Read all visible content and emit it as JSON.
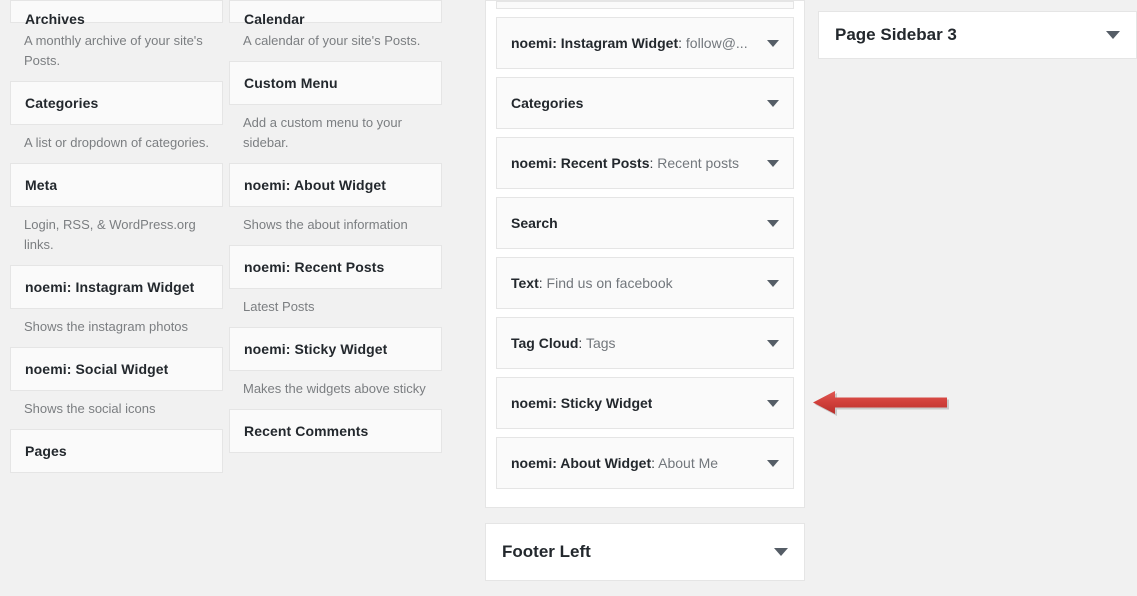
{
  "available_widgets": {
    "columns": [
      {
        "items": [
          {
            "title": "Archives",
            "description": "A monthly archive of your site's Posts.",
            "clipped": true
          },
          {
            "title": "Categories",
            "description": "A list or dropdown of categories.",
            "clipped": false
          },
          {
            "title": "Meta",
            "description": "Login, RSS, & WordPress.org links.",
            "clipped": false
          },
          {
            "title": "noemi: Instagram Widget",
            "description": "Shows the instagram photos",
            "clipped": false
          },
          {
            "title": "noemi: Social Widget",
            "description": "Shows the social icons",
            "clipped": false
          },
          {
            "title": "Pages",
            "description": "",
            "clipped": false
          }
        ]
      },
      {
        "items": [
          {
            "title": "Calendar",
            "description": "A calendar of your site's Posts.",
            "clipped": true
          },
          {
            "title": "Custom Menu",
            "description": "Add a custom menu to your sidebar.",
            "clipped": false
          },
          {
            "title": "noemi: About Widget",
            "description": "Shows the about information",
            "clipped": false
          },
          {
            "title": "noemi: Recent Posts",
            "description": "Latest Posts",
            "clipped": false
          },
          {
            "title": "noemi: Sticky Widget",
            "description": "Makes the widgets above sticky",
            "clipped": false
          },
          {
            "title": "Recent Comments",
            "description": "",
            "clipped": false
          }
        ]
      }
    ]
  },
  "sidebars": {
    "open_panel": {
      "widgets": [
        {
          "name": "",
          "instance": "",
          "partial": true
        },
        {
          "name": "noemi: Instagram Widget",
          "instance": "follow@...",
          "partial": false
        },
        {
          "name": "Categories",
          "instance": "",
          "partial": false
        },
        {
          "name": "noemi: Recent Posts",
          "instance": "Recent posts",
          "partial": false
        },
        {
          "name": "Search",
          "instance": "",
          "partial": false
        },
        {
          "name": "Text",
          "instance": "Find us on facebook",
          "partial": false
        },
        {
          "name": "Tag Cloud",
          "instance": "Tags",
          "partial": false
        },
        {
          "name": "noemi: Sticky Widget",
          "instance": "",
          "partial": false
        },
        {
          "name": "noemi: About Widget",
          "instance": "About Me",
          "partial": false
        }
      ]
    },
    "footer_left": {
      "title": "Footer Left"
    },
    "page_sidebar_3": {
      "title": "Page Sidebar 3"
    }
  },
  "annotation": {
    "arrow_color": "#cf3a35",
    "arrow_direction": "left",
    "points_at": "noemi: Sticky Widget"
  },
  "colors": {
    "page_background": "#f1f1f1",
    "card_background": "#fafafa",
    "panel_background": "#ffffff",
    "border": "#e5e5e5",
    "heading_text": "#23282d",
    "muted_text": "#72777c",
    "caret": "#555d66"
  }
}
